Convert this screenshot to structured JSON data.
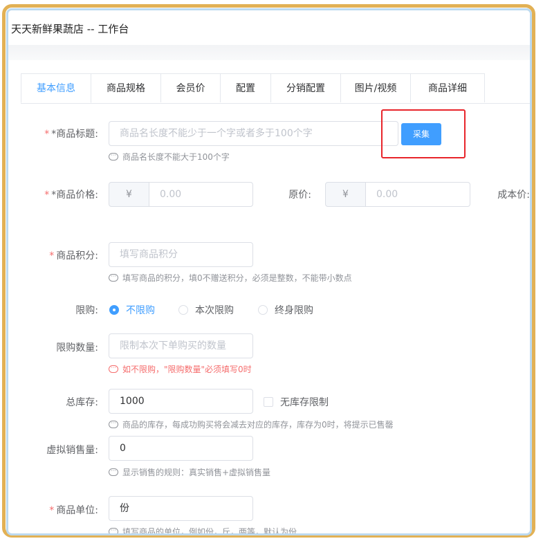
{
  "header": {
    "title": "天天新鲜果蔬店 -- 工作台"
  },
  "tabs": [
    {
      "label": "基本信息",
      "active": true
    },
    {
      "label": "商品规格"
    },
    {
      "label": "会员价"
    },
    {
      "label": "配置"
    },
    {
      "label": "分销配置"
    },
    {
      "label": "图片/视频"
    },
    {
      "label": "商品详细"
    }
  ],
  "form": {
    "title": {
      "required_mark": "*",
      "label": "*商品标题:",
      "placeholder": "商品名长度不能少于一个字或者多于100个字",
      "tip": "商品名长度不能大于100个字",
      "collect_button": "采集"
    },
    "price": {
      "required_mark": "*",
      "label": "*商品价格:",
      "currency": "¥",
      "placeholder": "0.00"
    },
    "original_price": {
      "label": "原价:",
      "currency": "¥",
      "placeholder": "0.00"
    },
    "cost_price": {
      "label": "成本价:"
    },
    "points": {
      "required_mark": "*",
      "label": "商品积分:",
      "placeholder": "填写商品积分",
      "tip": "填写商品的积分，填0不赠送积分，必须是整数，不能带小数点"
    },
    "limit": {
      "label": "限购:",
      "options": [
        "不限购",
        "本次限购",
        "终身限购"
      ],
      "selected": "不限购"
    },
    "limit_qty": {
      "label": "限购数量:",
      "placeholder": "限制本次下单购买的数量",
      "tip": "如不限购，\"限购数量\"必须填写0时"
    },
    "stock": {
      "label": "总库存:",
      "value": "1000",
      "unlimited_label": "无库存限制",
      "tip": "商品的库存，每成功购买将会减去对应的库存，库存为0时，将提示已售罄"
    },
    "virtual_sales": {
      "label": "虚拟销售量:",
      "value": "0",
      "tip": "显示销售的规则：真实销售+虚拟销售量"
    },
    "unit": {
      "required_mark": "*",
      "label": "商品单位:",
      "value": "份",
      "tip": "填写商品的单位，例如份，斤，两等，默认为份"
    }
  },
  "colors": {
    "primary": "#409eff",
    "danger": "#f56c6c",
    "frame_outer": "#e2b155",
    "frame_inner": "#bcd9ef",
    "highlight": "#e8242a"
  }
}
